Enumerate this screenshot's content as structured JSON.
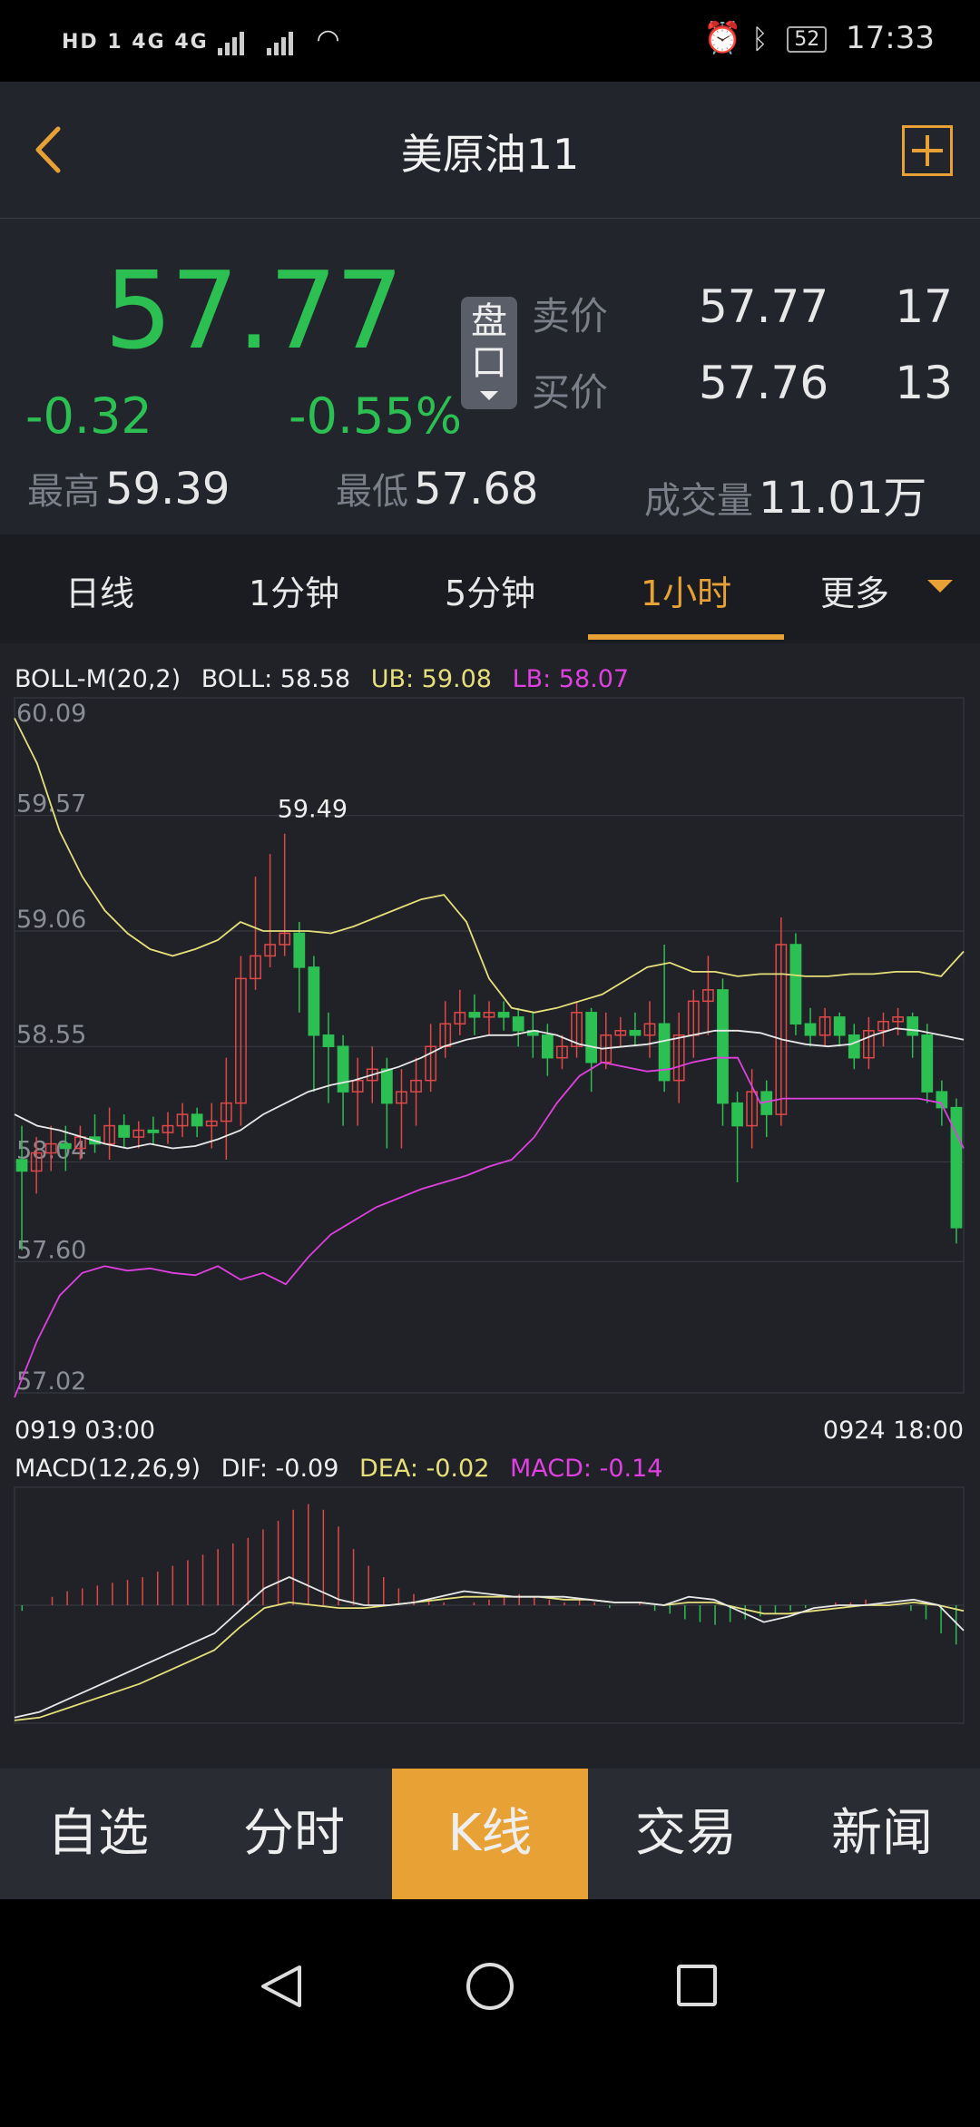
{
  "status_bar": {
    "left_text": "HD 1  4G  4G",
    "battery": "52",
    "time": "17:33"
  },
  "header": {
    "title": "美原油11"
  },
  "quote": {
    "price": "57.77",
    "change": "-0.32",
    "change_pct": "-0.55%",
    "pankou_label_1": "盘",
    "pankou_label_2": "口",
    "ask_label": "卖价",
    "ask_price": "57.77",
    "ask_volume": "17",
    "bid_label": "买价",
    "bid_price": "57.76",
    "bid_volume": "13",
    "high_label": "最高",
    "high_value": "59.39",
    "low_label": "最低",
    "low_value": "57.68",
    "volume_label": "成交量",
    "volume_value": "11.01万",
    "colors": {
      "down": "#2cbf52",
      "up": "#e04848",
      "accent": "#e8a134"
    }
  },
  "tabs": {
    "items": [
      "日线",
      "1分钟",
      "5分钟",
      "1小时",
      "更多"
    ],
    "active": "1小时"
  },
  "chart_data": [
    {
      "type": "candlestick",
      "legend": {
        "name": "BOLL-M(20,2)",
        "boll": "BOLL: 58.58",
        "ub": "UB: 59.08",
        "lb": "LB: 58.07"
      },
      "y_labels": [
        "60.09",
        "59.57",
        "59.06",
        "58.55",
        "58.04",
        "57.60",
        "57.02"
      ],
      "ylim": [
        57.02,
        60.09
      ],
      "x_labels": [
        "0919 03:00",
        "0924 18:00"
      ],
      "max_label": "59.49",
      "candles": [
        [
          58.05,
          58.0,
          58.2,
          57.65
        ],
        [
          58.0,
          58.08,
          58.15,
          57.9
        ],
        [
          58.08,
          58.12,
          58.2,
          58.0
        ],
        [
          58.12,
          58.1,
          58.2,
          58.0
        ],
        [
          58.1,
          58.15,
          58.2,
          58.05
        ],
        [
          58.15,
          58.12,
          58.25,
          58.08
        ],
        [
          58.12,
          58.2,
          58.28,
          58.05
        ],
        [
          58.2,
          58.15,
          58.25,
          58.1
        ],
        [
          58.15,
          58.18,
          58.22,
          58.1
        ],
        [
          58.18,
          58.17,
          58.24,
          58.12
        ],
        [
          58.17,
          58.2,
          58.26,
          58.12
        ],
        [
          58.2,
          58.25,
          58.3,
          58.15
        ],
        [
          58.25,
          58.2,
          58.28,
          58.15
        ],
        [
          58.2,
          58.22,
          58.3,
          58.1
        ],
        [
          58.22,
          58.3,
          58.5,
          58.05
        ],
        [
          58.3,
          58.85,
          58.95,
          58.2
        ],
        [
          58.85,
          58.95,
          59.3,
          58.8
        ],
        [
          58.95,
          59.0,
          59.4,
          58.9
        ],
        [
          59.0,
          59.05,
          59.49,
          58.95
        ],
        [
          59.05,
          58.9,
          59.1,
          58.7
        ],
        [
          58.9,
          58.6,
          58.95,
          58.35
        ],
        [
          58.6,
          58.55,
          58.7,
          58.3
        ],
        [
          58.55,
          58.35,
          58.6,
          58.2
        ],
        [
          58.35,
          58.4,
          58.5,
          58.2
        ],
        [
          58.4,
          58.45,
          58.55,
          58.3
        ],
        [
          58.45,
          58.3,
          58.5,
          58.1
        ],
        [
          58.3,
          58.35,
          58.45,
          58.1
        ],
        [
          58.35,
          58.4,
          58.5,
          58.2
        ],
        [
          58.4,
          58.55,
          58.65,
          58.35
        ],
        [
          58.55,
          58.65,
          58.75,
          58.5
        ],
        [
          58.65,
          58.7,
          58.8,
          58.6
        ],
        [
          58.7,
          58.68,
          58.78,
          58.6
        ],
        [
          58.68,
          58.7,
          58.75,
          58.6
        ],
        [
          58.7,
          58.68,
          58.75,
          58.62
        ],
        [
          58.68,
          58.62,
          58.72,
          58.55
        ],
        [
          58.62,
          58.6,
          58.7,
          58.5
        ],
        [
          58.6,
          58.5,
          58.65,
          58.42
        ],
        [
          58.5,
          58.55,
          58.6,
          58.45
        ],
        [
          58.55,
          58.7,
          58.75,
          58.5
        ],
        [
          58.7,
          58.48,
          58.72,
          58.35
        ],
        [
          58.48,
          58.6,
          58.7,
          58.45
        ],
        [
          58.6,
          58.62,
          58.68,
          58.55
        ],
        [
          58.62,
          58.6,
          58.7,
          58.55
        ],
        [
          58.6,
          58.65,
          58.75,
          58.5
        ],
        [
          58.65,
          58.4,
          59.0,
          58.35
        ],
        [
          58.4,
          58.6,
          58.7,
          58.3
        ],
        [
          58.6,
          58.75,
          58.8,
          58.5
        ],
        [
          58.75,
          58.8,
          58.95,
          58.6
        ],
        [
          58.8,
          58.3,
          58.85,
          58.2
        ],
        [
          58.3,
          58.2,
          58.35,
          57.95
        ],
        [
          58.2,
          58.35,
          58.45,
          58.1
        ],
        [
          58.35,
          58.25,
          58.4,
          58.15
        ],
        [
          58.25,
          59.0,
          59.12,
          58.2
        ],
        [
          59.0,
          58.65,
          59.05,
          58.6
        ],
        [
          58.65,
          58.6,
          58.72,
          58.55
        ],
        [
          58.6,
          58.68,
          58.72,
          58.55
        ],
        [
          58.68,
          58.6,
          58.7,
          58.55
        ],
        [
          58.6,
          58.5,
          58.65,
          58.45
        ],
        [
          58.5,
          58.62,
          58.68,
          58.45
        ],
        [
          58.62,
          58.66,
          58.7,
          58.55
        ],
        [
          58.66,
          58.68,
          58.72,
          58.6
        ],
        [
          58.68,
          58.6,
          58.7,
          58.5
        ],
        [
          58.6,
          58.35,
          58.65,
          58.3
        ],
        [
          58.35,
          58.28,
          58.4,
          58.2
        ],
        [
          58.28,
          57.75,
          58.32,
          57.68
        ]
      ],
      "boll_mid": [
        58.25,
        58.2,
        58.18,
        58.15,
        58.12,
        58.1,
        58.12,
        58.1,
        58.11,
        58.14,
        58.18,
        58.25,
        58.3,
        58.35,
        58.38,
        58.4,
        58.43,
        58.46,
        58.5,
        58.55,
        58.58,
        58.6,
        58.6,
        58.62,
        58.6,
        58.56,
        58.54,
        58.55,
        58.56,
        58.58,
        58.6,
        58.62,
        58.62,
        58.61,
        58.58,
        58.56,
        58.55,
        58.56,
        58.6,
        58.63,
        58.62,
        58.6,
        58.58
      ],
      "boll_upper": [
        60.0,
        59.8,
        59.5,
        59.3,
        59.15,
        59.05,
        58.98,
        58.95,
        58.98,
        59.02,
        59.1,
        59.06,
        59.06,
        59.06,
        59.05,
        59.08,
        59.12,
        59.16,
        59.2,
        59.22,
        59.1,
        58.85,
        58.72,
        58.7,
        58.72,
        58.75,
        58.78,
        58.84,
        58.9,
        58.92,
        58.88,
        58.88,
        58.86,
        58.87,
        58.87,
        58.86,
        58.86,
        58.87,
        58.87,
        58.88,
        58.88,
        58.86,
        58.97
      ],
      "boll_lower": [
        57.0,
        57.25,
        57.45,
        57.55,
        57.58,
        57.56,
        57.57,
        57.55,
        57.54,
        57.58,
        57.52,
        57.55,
        57.5,
        57.62,
        57.72,
        57.78,
        57.84,
        57.88,
        57.92,
        57.95,
        57.98,
        58.02,
        58.05,
        58.15,
        58.3,
        58.42,
        58.48,
        58.46,
        58.44,
        58.45,
        58.48,
        58.5,
        58.5,
        58.3,
        58.32,
        58.32,
        58.32,
        58.32,
        58.32,
        58.32,
        58.32,
        58.3,
        58.1
      ]
    },
    {
      "type": "macd",
      "legend": {
        "name": "MACD(12,26,9)",
        "dif": "DIF: -0.09",
        "dea": "DEA: -0.02",
        "macd": "MACD: -0.14"
      },
      "histogram": [
        -0.02,
        0.0,
        0.03,
        0.05,
        0.06,
        0.07,
        0.08,
        0.09,
        0.1,
        0.12,
        0.14,
        0.16,
        0.18,
        0.2,
        0.22,
        0.24,
        0.27,
        0.3,
        0.34,
        0.36,
        0.34,
        0.28,
        0.2,
        0.14,
        0.1,
        0.06,
        0.04,
        0.02,
        0.01,
        0.0,
        0.01,
        0.02,
        0.03,
        0.04,
        0.03,
        0.02,
        0.01,
        0.02,
        0.01,
        -0.01,
        0.0,
        0.01,
        -0.02,
        -0.03,
        -0.05,
        -0.06,
        -0.07,
        -0.06,
        -0.05,
        -0.04,
        -0.03,
        -0.02,
        -0.01,
        0.0,
        0.01,
        0.01,
        0.02,
        0.01,
        0.0,
        -0.02,
        -0.05,
        -0.1,
        -0.14
      ],
      "dif": [
        -0.4,
        -0.38,
        -0.34,
        -0.3,
        -0.26,
        -0.22,
        -0.18,
        -0.14,
        -0.1,
        -0.02,
        0.06,
        0.1,
        0.06,
        0.02,
        0.0,
        0.0,
        0.01,
        0.03,
        0.05,
        0.04,
        0.03,
        0.03,
        0.03,
        0.02,
        0.01,
        0.01,
        0.0,
        0.03,
        0.02,
        -0.02,
        -0.06,
        -0.04,
        -0.01,
        0.0,
        0.0,
        0.01,
        0.02,
        0.0,
        -0.09
      ],
      "dea": [
        -0.41,
        -0.4,
        -0.37,
        -0.34,
        -0.31,
        -0.28,
        -0.24,
        -0.2,
        -0.16,
        -0.08,
        -0.01,
        0.01,
        0.0,
        -0.01,
        -0.01,
        0.0,
        0.01,
        0.02,
        0.03,
        0.03,
        0.03,
        0.03,
        0.02,
        0.02,
        0.01,
        0.01,
        0.0,
        0.01,
        0.01,
        -0.01,
        -0.03,
        -0.03,
        -0.02,
        -0.01,
        0.0,
        0.0,
        0.01,
        0.0,
        -0.02
      ],
      "ylim": [
        -0.42,
        0.42
      ]
    }
  ],
  "bottom_nav": {
    "items": [
      "自选",
      "分时",
      "K线",
      "交易",
      "新闻"
    ],
    "active": "K线"
  }
}
